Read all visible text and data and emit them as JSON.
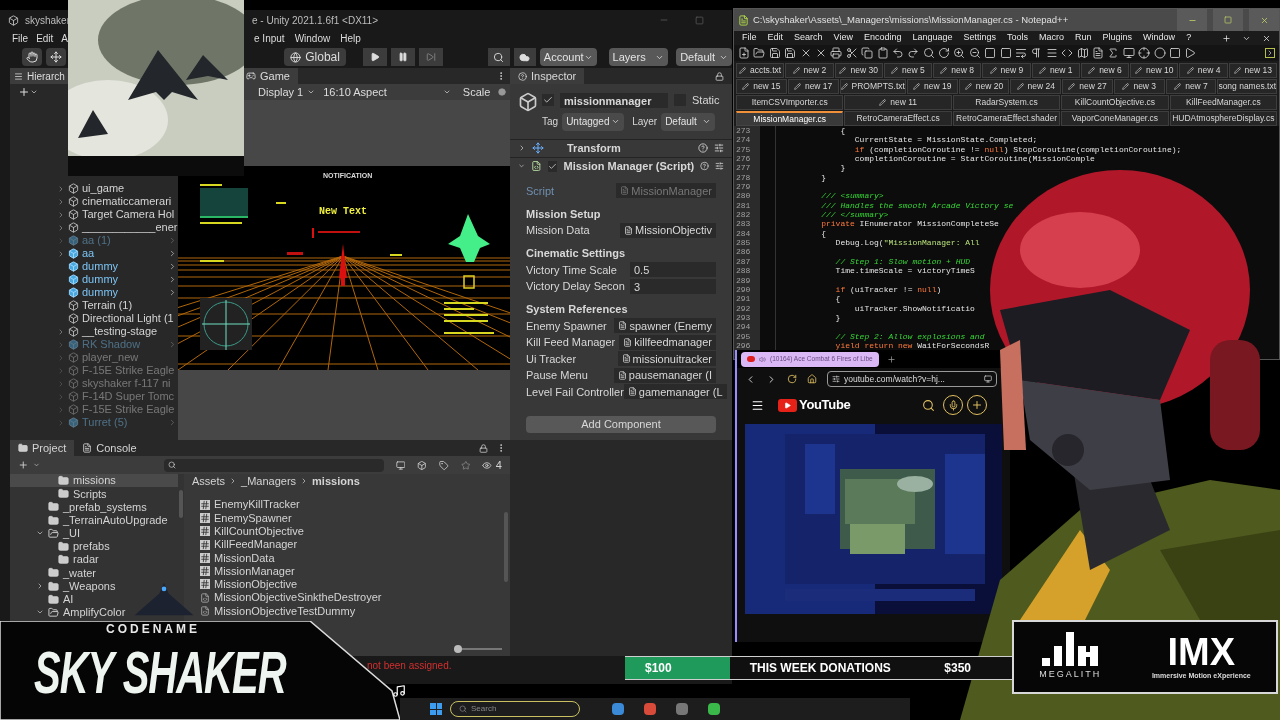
{
  "unity": {
    "title": "skyshaker",
    "title_tail": "e - Unity 2021.1.6f1 <DX11>",
    "menu_left": [
      "File",
      "Edit",
      "A"
    ],
    "menu_right": [
      "e Input",
      "Window",
      "Help"
    ],
    "toolbar": {
      "pivot": "Global",
      "account": "Account",
      "layers": "Layers",
      "layout": "Default"
    },
    "hierarchy": {
      "title": "Hierarch",
      "items": [
        {
          "label": "ui_game",
          "prefab": false,
          "disabled": false,
          "expandable": true
        },
        {
          "label": "cinematiccamerari",
          "prefab": false,
          "disabled": false,
          "expandable": true
        },
        {
          "label": "Target Camera Hol",
          "prefab": false,
          "disabled": false,
          "expandable": true
        },
        {
          "label": "____________ener",
          "prefab": false,
          "disabled": false,
          "expandable": true
        },
        {
          "label": "aa (1)",
          "prefab": true,
          "disabled": true,
          "expandable": true
        },
        {
          "label": "aa",
          "prefab": true,
          "disabled": false,
          "expandable": true
        },
        {
          "label": "dummy",
          "prefab": true,
          "disabled": false,
          "expandable": false
        },
        {
          "label": "dummy",
          "prefab": true,
          "disabled": false,
          "expandable": false
        },
        {
          "label": "dummy",
          "prefab": true,
          "disabled": false,
          "expandable": false
        },
        {
          "label": "Terrain (1)",
          "prefab": false,
          "disabled": false,
          "expandable": false
        },
        {
          "label": "Directional Light (1",
          "prefab": false,
          "disabled": false,
          "expandable": false
        },
        {
          "label": "__testing-stage",
          "prefab": false,
          "disabled": false,
          "expandable": true
        },
        {
          "label": "RK Shadow",
          "prefab": true,
          "disabled": true,
          "expandable": true
        },
        {
          "label": "player_new",
          "prefab": false,
          "disabled": true,
          "expandable": true
        },
        {
          "label": "F-15E Strike Eagle",
          "prefab": false,
          "disabled": true,
          "expandable": true
        },
        {
          "label": "skyshaker f-117 ni",
          "prefab": false,
          "disabled": true,
          "expandable": true
        },
        {
          "label": "F-14D Super Tomc",
          "prefab": false,
          "disabled": true,
          "expandable": true
        },
        {
          "label": "F-15E Strike Eagle",
          "prefab": false,
          "disabled": true,
          "expandable": true
        },
        {
          "label": "Turret (5)",
          "prefab": true,
          "disabled": true,
          "expandable": true
        }
      ]
    },
    "game": {
      "tab": "Game",
      "display": "Display 1",
      "aspect": "16:10 Aspect",
      "scale": "Scale",
      "notification": "NOTIFICATION",
      "hud_text": "New Text"
    },
    "inspector": {
      "tab": "Inspector",
      "object_name": "missionmanager",
      "active": true,
      "static_label": "Static",
      "static": false,
      "tag_label": "Tag",
      "tag": "Untagged",
      "layer_label": "Layer",
      "layer": "Default",
      "components": [
        {
          "kind": "transform",
          "label": "Transform",
          "expanded": false
        },
        {
          "kind": "script",
          "label": "Mission Manager (Script)",
          "expanded": true,
          "enabled": true
        }
      ],
      "fields": [
        {
          "kind": "script",
          "label": "Script",
          "value": "MissionManager",
          "disabled": true
        },
        {
          "kind": "header",
          "label": "Mission Setup"
        },
        {
          "kind": "object",
          "label": "Mission Data",
          "value": "MissionObjectiv"
        },
        {
          "kind": "header",
          "label": "Cinematic Settings"
        },
        {
          "kind": "number",
          "label": "Victory Time Scale",
          "value": "0.5"
        },
        {
          "kind": "number",
          "label": "Victory Delay Secon",
          "value": "3"
        },
        {
          "kind": "header",
          "label": "System References"
        },
        {
          "kind": "object",
          "label": "Enemy Spawner",
          "value": "spawner (Enemy"
        },
        {
          "kind": "object",
          "label": "Kill Feed Manager",
          "value": "killfeedmanager"
        },
        {
          "kind": "object",
          "label": "Ui Tracker",
          "value": "missionuitracker"
        },
        {
          "kind": "object",
          "label": "Pause Menu",
          "value": "pausemanager (I"
        },
        {
          "kind": "object",
          "label": "Level Fail Controller",
          "value": "gamemanager (L"
        }
      ],
      "add_component": "Add Component"
    },
    "project": {
      "tabs": [
        {
          "label": "Project",
          "selected": true
        },
        {
          "label": "Console",
          "selected": false
        }
      ],
      "hidden_count": "4",
      "tree": [
        {
          "children": [
            {
              "label": "missions",
              "selected": true
            },
            {
              "label": "Scripts",
              "selected": false
            }
          ]
        },
        {
          "label": "_prefab_systems",
          "selected": false
        },
        {
          "label": "_TerrainAutoUpgrade",
          "selected": false
        },
        {
          "label": "_UI",
          "selected": false,
          "expanded": true,
          "children": [
            {
              "label": "prefabs",
              "selected": false
            },
            {
              "label": "radar",
              "selected": false
            }
          ]
        },
        {
          "label": "_water",
          "selected": false
        },
        {
          "label": "_Weapons",
          "selected": false,
          "expanded": false
        },
        {
          "label": "AI",
          "selected": false
        },
        {
          "label": "AmplifyColor",
          "selected": false,
          "expanded": true
        }
      ],
      "breadcrumb": [
        "Assets",
        "_Managers",
        "missions"
      ],
      "files": [
        {
          "label": "EnemyKillTracker",
          "kind": "script"
        },
        {
          "label": "EnemySpawner",
          "kind": "script"
        },
        {
          "label": "KillCountObjective",
          "kind": "script"
        },
        {
          "label": "KillFeedManager",
          "kind": "script"
        },
        {
          "label": "MissionData",
          "kind": "script"
        },
        {
          "label": "MissionManager",
          "kind": "script"
        },
        {
          "label": "MissionObjective",
          "kind": "script"
        },
        {
          "label": "MissionObjectiveSinktheDestroyer",
          "kind": "asset"
        },
        {
          "label": "MissionObjectiveTestDummy",
          "kind": "asset"
        }
      ],
      "zoom_slider": {
        "level": 0
      }
    },
    "status_error": "not been assigned."
  },
  "notepad": {
    "title": "C:\\skyshaker\\Assets\\_Managers\\missions\\MissionManager.cs - Notepad++",
    "menu": [
      "File",
      "Edit",
      "Search",
      "View",
      "Encoding",
      "Language",
      "Settings",
      "Tools",
      "Macro",
      "Run",
      "Plugins",
      "Window",
      "?"
    ],
    "tab_rows": [
      [
        {
          "label": "accts.txt",
          "modified": true,
          "selected": false
        },
        {
          "label": "new 2",
          "modified": true,
          "selected": false
        },
        {
          "label": "new 30",
          "modified": true,
          "selected": false
        },
        {
          "label": "new 5",
          "modified": true,
          "selected": false
        },
        {
          "label": "new 8",
          "modified": true,
          "selected": false
        },
        {
          "label": "new 9",
          "modified": true,
          "selected": false
        },
        {
          "label": "new 1",
          "modified": true,
          "selected": false
        },
        {
          "label": "new 6",
          "modified": true,
          "selected": false
        },
        {
          "label": "new 10",
          "modified": true,
          "selected": false
        },
        {
          "label": "new 4",
          "modified": true,
          "selected": false
        },
        {
          "label": "new 13",
          "modified": true,
          "selected": false
        }
      ],
      [
        {
          "label": "new 15",
          "modified": true,
          "selected": false
        },
        {
          "label": "new 17",
          "modified": true,
          "selected": false
        },
        {
          "label": "PROMPTS.txt",
          "modified": true,
          "selected": false
        },
        {
          "label": "new 19",
          "modified": true,
          "selected": false
        },
        {
          "label": "new 20",
          "modified": true,
          "selected": false
        },
        {
          "label": "new 24",
          "modified": true,
          "selected": false
        },
        {
          "label": "new 27",
          "modified": true,
          "selected": false
        },
        {
          "label": "new 3",
          "modified": true,
          "selected": false
        },
        {
          "label": "new 7",
          "modified": true,
          "selected": false
        },
        {
          "label": "song names.txt",
          "modified": false,
          "selected": false
        }
      ],
      [
        {
          "label": "ItemCSVImporter.cs",
          "modified": false,
          "selected": false
        },
        {
          "label": "new 11",
          "modified": true,
          "selected": false
        },
        {
          "label": "RadarSystem.cs",
          "modified": false,
          "selected": false
        },
        {
          "label": "KillCountObjective.cs",
          "modified": false,
          "selected": false
        },
        {
          "label": "KillFeedManager.cs",
          "modified": false,
          "selected": false
        }
      ],
      [
        {
          "label": "MissionManager.cs",
          "modified": false,
          "selected": true
        },
        {
          "label": "RetroCameraEffect.cs",
          "modified": false,
          "selected": false
        },
        {
          "label": "RetroCameraEffect.shader",
          "modified": false,
          "selected": false
        },
        {
          "label": "VaporConeManager.cs",
          "modified": false,
          "selected": false
        },
        {
          "label": "HUDAtmosphereDisplay.cs",
          "modified": false,
          "selected": false
        }
      ]
    ],
    "lines": [
      {
        "number": "273",
        "segments": [
          {
            "text": "             {",
            "kind": "plain"
          }
        ]
      },
      {
        "number": "274",
        "segments": [
          {
            "text": "                CurrentState = MissionState.Completed;",
            "kind": "plain"
          }
        ]
      },
      {
        "number": "275",
        "segments": [
          {
            "text": "                if",
            "kind": "keyword"
          },
          {
            "text": " (completionCoroutine != ",
            "kind": "plain"
          },
          {
            "text": "null",
            "kind": "keyword"
          },
          {
            "text": ") StopCoroutine(completionCoroutine);",
            "kind": "plain"
          }
        ]
      },
      {
        "number": "276",
        "segments": [
          {
            "text": "                completionCoroutine = StartCoroutine(MissionComple",
            "kind": "plain"
          }
        ]
      },
      {
        "number": "277",
        "segments": [
          {
            "text": "             }",
            "kind": "plain"
          }
        ]
      },
      {
        "number": "278",
        "segments": [
          {
            "text": "         }",
            "kind": "plain"
          }
        ]
      },
      {
        "number": "279"
      },
      {
        "number": "280",
        "segments": [
          {
            "text": "         /// <summary>",
            "kind": "comment"
          }
        ]
      },
      {
        "number": "281",
        "segments": [
          {
            "text": "         /// Handles the smooth Arcade Victory se",
            "kind": "comment"
          }
        ]
      },
      {
        "number": "282",
        "segments": [
          {
            "text": "         /// </summary>",
            "kind": "comment"
          }
        ]
      },
      {
        "number": "283",
        "segments": [
          {
            "text": "         private",
            "kind": "keyword"
          },
          {
            "text": " IEnumerator MissionCompleteSe",
            "kind": "plain"
          }
        ]
      },
      {
        "number": "284",
        "segments": [
          {
            "text": "         {",
            "kind": "plain"
          }
        ]
      },
      {
        "number": "285",
        "segments": [
          {
            "text": "            Debug.Log(",
            "kind": "plain"
          },
          {
            "text": "\"MissionManager: All",
            "kind": "string"
          }
        ]
      },
      {
        "number": "286"
      },
      {
        "number": "287",
        "segments": [
          {
            "text": "            // Step 1: Slow motion + HUD",
            "kind": "comment"
          }
        ]
      },
      {
        "number": "288",
        "segments": [
          {
            "text": "            Time.timeScale = victoryTimeS",
            "kind": "plain"
          }
        ]
      },
      {
        "number": "289"
      },
      {
        "number": "290",
        "segments": [
          {
            "text": "            if",
            "kind": "keyword"
          },
          {
            "text": " (uiTracker != ",
            "kind": "plain"
          },
          {
            "text": "null",
            "kind": "keyword"
          },
          {
            "text": ")",
            "kind": "plain"
          }
        ]
      },
      {
        "number": "291",
        "segments": [
          {
            "text": "            {",
            "kind": "plain"
          }
        ]
      },
      {
        "number": "292",
        "segments": [
          {
            "text": "                uiTracker.ShowNotificatio",
            "kind": "plain"
          }
        ]
      },
      {
        "number": "293",
        "segments": [
          {
            "text": "            }",
            "kind": "plain"
          }
        ]
      },
      {
        "number": "294"
      },
      {
        "number": "295",
        "segments": [
          {
            "text": "            // Step 2: Allow explosions and",
            "kind": "comment"
          }
        ]
      },
      {
        "number": "296",
        "segments": [
          {
            "text": "            yield return new",
            "kind": "keyword"
          },
          {
            "text": " WaitForSecondsR",
            "kind": "plain"
          }
        ]
      }
    ]
  },
  "browser": {
    "tab_title": "(10164) Ace Combat 6 Fires of Libe",
    "url": "youtube.com/watch?v=hj...",
    "site_name": "YouTube"
  },
  "overlay": {
    "codename": "CODENAME",
    "game_title": "SKY SHAKER",
    "donations": {
      "raised": "$100",
      "label": "THIS WEEK DONATIONS",
      "goal": "$350",
      "level": 0.27
    },
    "sponsor_one": "MEGALITH",
    "sponsor_two": "IMX",
    "sponsor_two_tagline": "Immersive Motion eXperience"
  },
  "taskbar": {
    "search_placeholder": "Search"
  }
}
